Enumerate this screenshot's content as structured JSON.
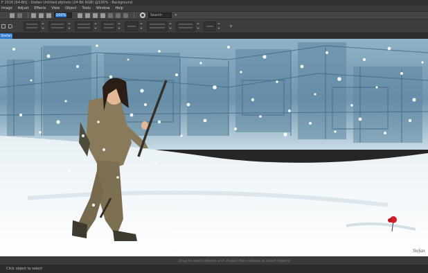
{
  "window": {
    "title": "F 2016 [64-Bit] - Stefan Untitled.afphoto (24-Bit RGB) @100% - Background"
  },
  "menu": {
    "items": [
      "Image",
      "Adjust",
      "Effects",
      "View",
      "Object",
      "Tools",
      "Window",
      "Help"
    ]
  },
  "toolbar": {
    "zoom_value": "100%",
    "search_placeholder": "Search",
    "search_caret": "▾"
  },
  "context_toolbar": {
    "add_label": "+"
  },
  "document": {
    "tab_label": "Stefan Untitled.afphoto"
  },
  "canvas": {
    "signature": "Stefan"
  },
  "hint_bar": {
    "text": "Drag to select objects and shapes then release to select objects"
  },
  "status_bar": {
    "text": "Click object to select"
  }
}
